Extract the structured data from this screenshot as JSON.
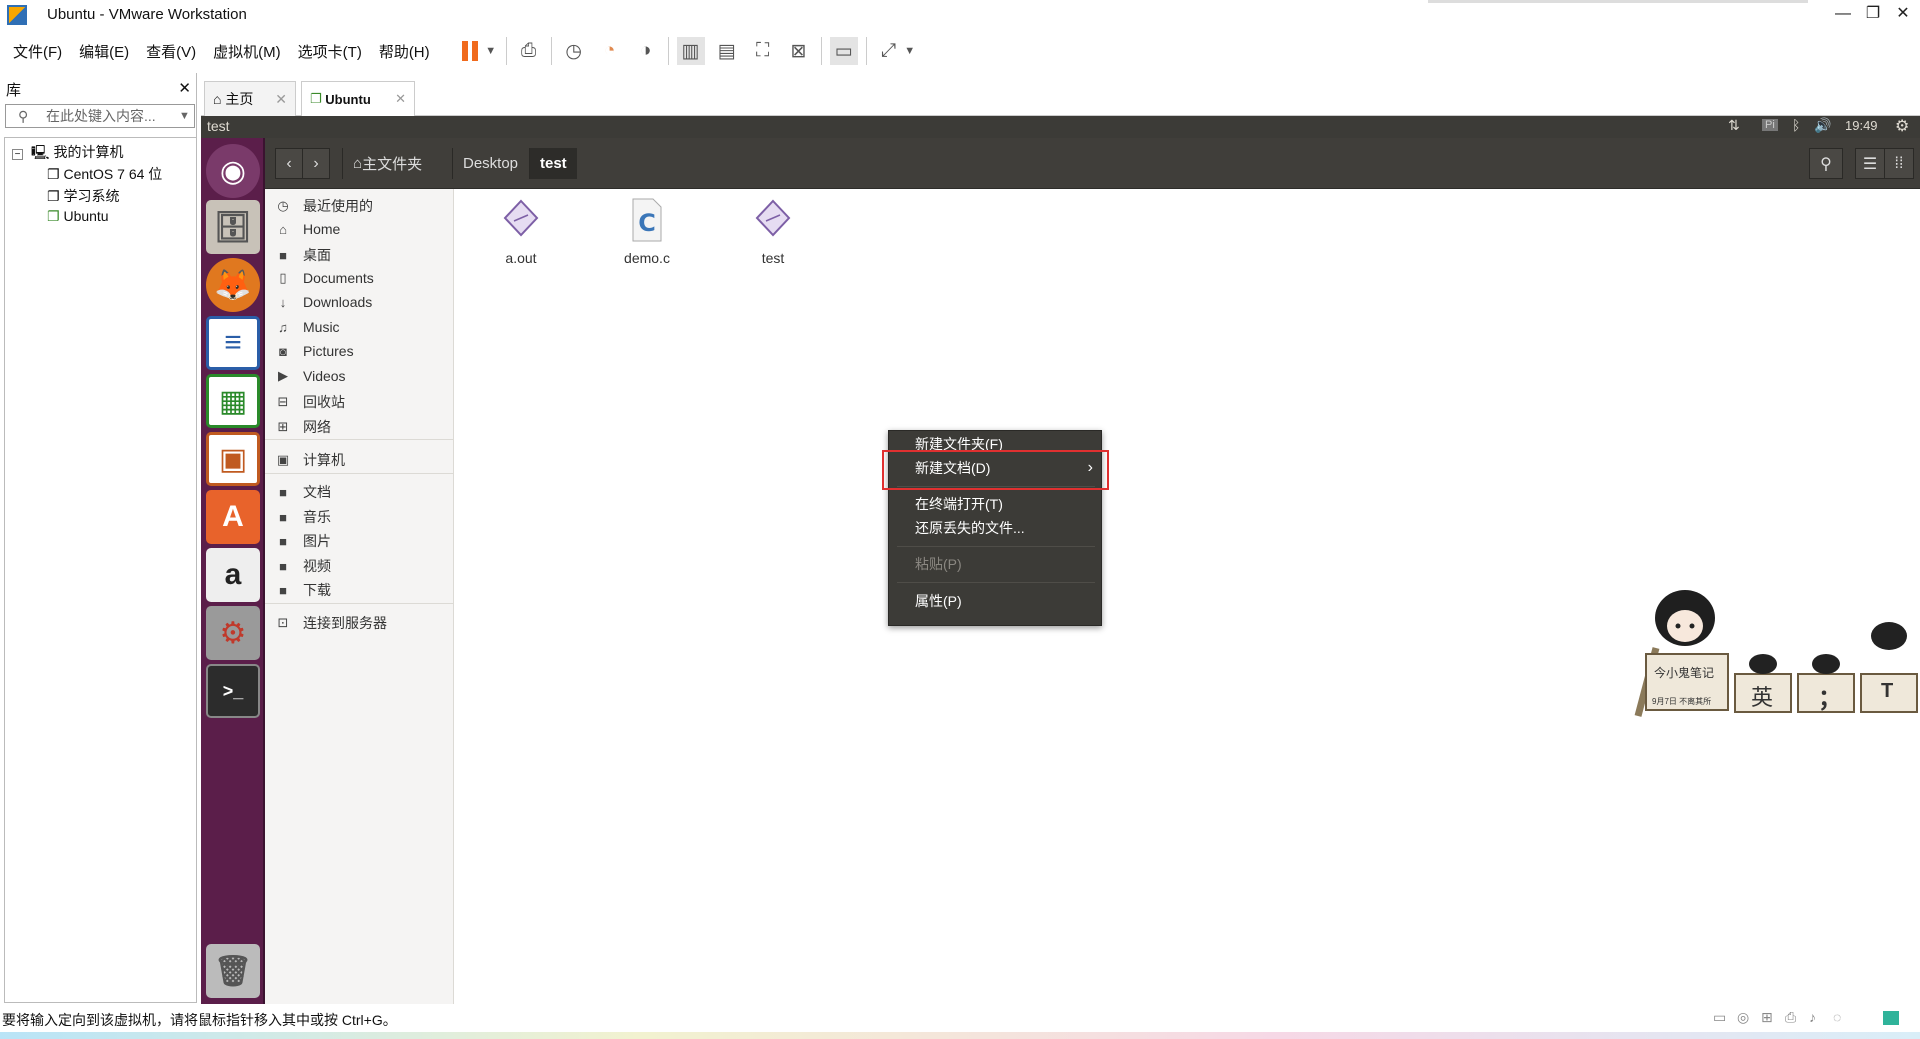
{
  "window": {
    "title": "Ubuntu - VMware Workstation"
  },
  "menus": [
    "文件(F)",
    "编辑(E)",
    "查看(V)",
    "虚拟机(M)",
    "选项卡(T)",
    "帮助(H)"
  ],
  "library": {
    "title": "库",
    "search_placeholder": "在此处键入内容...",
    "tree": {
      "root": "我的计算机",
      "items": [
        "CentOS 7 64 位",
        "学习系统",
        "Ubuntu"
      ]
    }
  },
  "tabs": [
    {
      "label": "主页"
    },
    {
      "label": "Ubuntu"
    }
  ],
  "vm": {
    "topbar": {
      "window_title": "test",
      "time": "19:49",
      "keyboard": "Pi"
    },
    "breadcrumb": [
      "主文件夹",
      "Desktop",
      "test"
    ],
    "sidebar": [
      {
        "label": "最近使用的",
        "icon": "clock-icon"
      },
      {
        "label": "Home",
        "icon": "home-icon"
      },
      {
        "label": "桌面",
        "icon": "folder-icon"
      },
      {
        "label": "Documents",
        "icon": "document-icon"
      },
      {
        "label": "Downloads",
        "icon": "download-icon"
      },
      {
        "label": "Music",
        "icon": "music-icon"
      },
      {
        "label": "Pictures",
        "icon": "camera-icon"
      },
      {
        "label": "Videos",
        "icon": "video-icon"
      },
      {
        "label": "回收站",
        "icon": "trash-icon"
      },
      {
        "label": "网络",
        "icon": "network-icon"
      },
      {
        "label": "计算机",
        "icon": "computer-icon"
      },
      {
        "label": "文档",
        "icon": "folder-icon"
      },
      {
        "label": "音乐",
        "icon": "folder-icon"
      },
      {
        "label": "图片",
        "icon": "folder-icon"
      },
      {
        "label": "视频",
        "icon": "folder-icon"
      },
      {
        "label": "下载",
        "icon": "folder-icon"
      },
      {
        "label": "连接到服务器",
        "icon": "server-icon"
      }
    ],
    "files": [
      {
        "name": "a.out",
        "icon": "executable-icon"
      },
      {
        "name": "demo.c",
        "icon": "c-source-icon"
      },
      {
        "name": "test",
        "icon": "executable-icon"
      }
    ],
    "context_menu": {
      "items": [
        {
          "label": "新建文件夹(F)",
          "enabled": true
        },
        {
          "label": "新建文档(D)",
          "enabled": true,
          "submenu": true
        },
        {
          "label": "在终端打开(T)",
          "enabled": true
        },
        {
          "label": "还原丢失的文件...",
          "enabled": true
        },
        {
          "label": "粘贴(P)",
          "enabled": false
        },
        {
          "label": "属性(P)",
          "enabled": true
        }
      ]
    },
    "mascot": {
      "sign": "今小鬼笔记",
      "date": "9月7日 不离其所",
      "box_labels": [
        "英",
        "；",
        "T"
      ]
    }
  },
  "statusbar": {
    "message": "要将输入定向到该虚拟机，请将鼠标指针移入其中或按 Ctrl+G。"
  },
  "colors": {
    "ubuntu_launcher": "#5b1e4a",
    "unity_panel": "#3c3b37",
    "highlight_border": "#e03030"
  }
}
